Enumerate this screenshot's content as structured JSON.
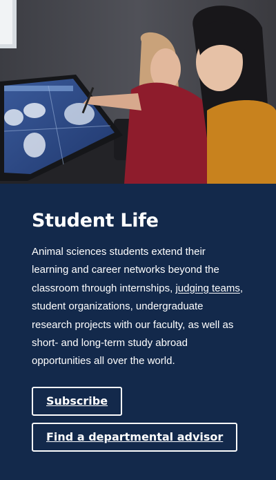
{
  "hero": {
    "image_icon": "students-lab-photo"
  },
  "section": {
    "title": "Student Life",
    "description_part1": "Animal sciences students extend their learning and career networks beyond the classroom through internships, ",
    "description_link": "judging teams",
    "description_part2": ", student organizations, undergraduate research projects with our faculty, as well as short- and long-term study abroad opportunities all over the world."
  },
  "buttons": {
    "subscribe_label": "Subscribe",
    "advisor_label": "Find a departmental advisor"
  },
  "colors": {
    "background": "#13294b",
    "text": "#ffffff",
    "button_border": "#ffffff"
  }
}
